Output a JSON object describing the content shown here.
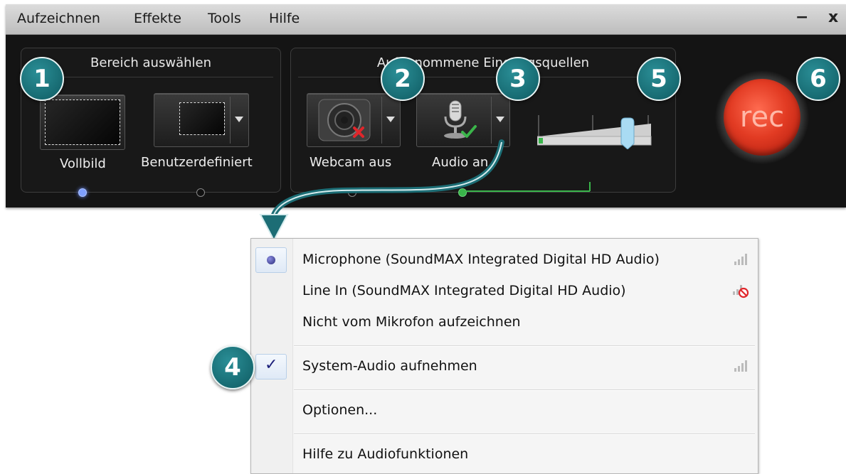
{
  "menubar": {
    "items": [
      "Aufzeichnen",
      "Effekte",
      "Tools",
      "Hilfe"
    ],
    "minimize": "−",
    "close": "x"
  },
  "area_panel": {
    "title": "Bereich auswählen",
    "fullscreen_label": "Vollbild",
    "custom_label": "Benutzerdefiniert"
  },
  "sources_panel": {
    "title": "Aufgenommene Eingangsquellen",
    "webcam_label": "Webcam aus",
    "audio_label": "Audio an",
    "webcam_icon": "webcam-off-icon",
    "audio_icon": "microphone-on-icon"
  },
  "rec_button": {
    "label": "rec"
  },
  "callouts": [
    "1",
    "2",
    "3",
    "4",
    "5",
    "6"
  ],
  "audio_menu": {
    "items": [
      {
        "label": "Microphone (SoundMAX Integrated Digital HD Audio)",
        "state": "radio-selected",
        "signal": "signal-bars-icon"
      },
      {
        "label": "Line In (SoundMAX Integrated Digital HD Audio)",
        "state": "none",
        "signal": "signal-muted-icon"
      },
      {
        "label": "Nicht vom Mikrofon aufzeichnen",
        "state": "none"
      },
      {
        "label": "System-Audio aufnehmen",
        "state": "checked",
        "signal": "signal-bars-icon"
      },
      {
        "label": "Optionen...",
        "state": "none"
      },
      {
        "label": "Hilfe zu Audiofunktionen",
        "state": "none"
      }
    ]
  },
  "colors": {
    "callout": "#1b7a82",
    "rec": "#e23b23",
    "accent_green": "#39b54a"
  }
}
